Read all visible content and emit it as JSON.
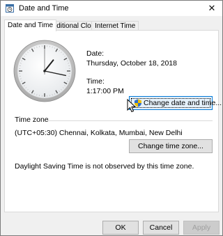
{
  "window": {
    "title": "Date and Time",
    "close_glyph": "✕"
  },
  "tabs": [
    {
      "label": "Date and Time",
      "active": true
    },
    {
      "label": "Additional Clocks",
      "active": false
    },
    {
      "label": "Internet Time",
      "active": false
    }
  ],
  "clock": {
    "hour": 1,
    "minute": 17,
    "second": 0
  },
  "date_section": {
    "label": "Date:",
    "value": "Thursday, October 18, 2018"
  },
  "time_section": {
    "label": "Time:",
    "value": "1:17:00 PM"
  },
  "change_date_button": {
    "label": "Change date and time...",
    "icon": "uac-shield-icon"
  },
  "timezone": {
    "heading": "Time zone",
    "value": "(UTC+05:30) Chennai, Kolkata, Mumbai, New Delhi",
    "change_button": "Change time zone..."
  },
  "dst_note": "Daylight Saving Time is not observed by this time zone.",
  "footer": {
    "ok": "OK",
    "cancel": "Cancel",
    "apply": "Apply"
  },
  "colors": {
    "accent": "#0078d7",
    "window_bg": "#f0f0f0",
    "panel_bg": "#ffffff"
  }
}
